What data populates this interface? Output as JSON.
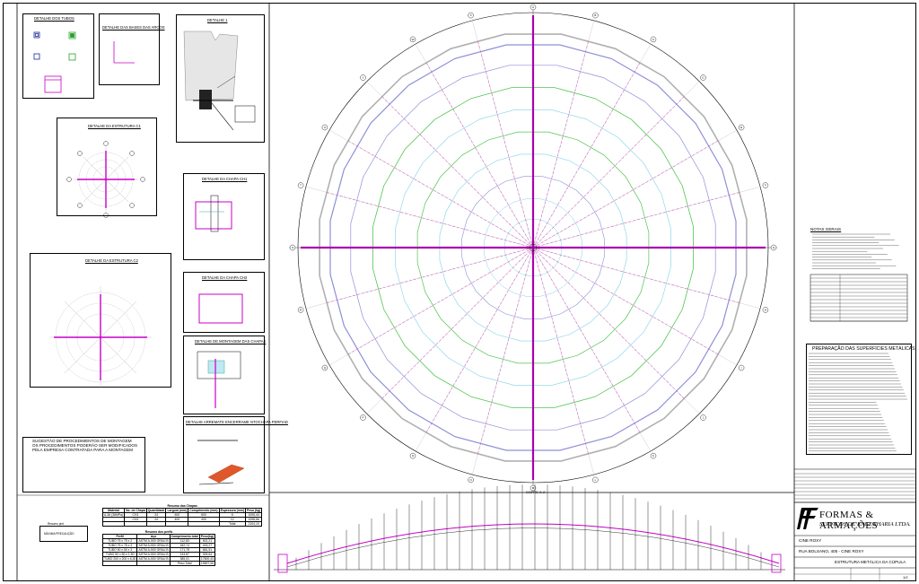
{
  "details": {
    "tubos": "DETALHE DOS TUBOS",
    "bases": "DETALHE DAS BASES DAS ARCOS",
    "d1": "DETALHE 1",
    "estrutura_c1": "DETALHE DA ESTRUTURA C1",
    "estrutura_c2": "DETALHE DA ESTRUTURA C2",
    "chapa_ch1": "DETALHE DA CHAPA CH1",
    "chapa_ch2": "DETALHE DA CHAPA CH2",
    "montagem": "DETALHE DE MONTAGEM DAS CHAPAS",
    "arremate": "DETALHE ARREMATE ENCERRAME NTOCHAPA PERFIAD"
  },
  "suggestion": {
    "title_lines": [
      "SUGESTÃO DE PROCEDIMENTOS DE MONTAGEM",
      "OS PROCEDIMENTOS PODERÃO SER MODIFICADOS",
      "PELA EMPRESA CONTRATADA PARA A MONTAGEM"
    ]
  },
  "notes": {
    "geral_title": "NOTAS GERAIS",
    "prep_title": "PREPARAÇÃO DAS SUPERFÍCIES METÁLICAS"
  },
  "plan": {
    "ring_labels": [
      "A",
      "B",
      "C",
      "D",
      "E",
      "F",
      "G",
      "H",
      "I",
      "J",
      "K",
      "L",
      "M",
      "N",
      "O",
      "P",
      "Q",
      "R",
      "S",
      "T",
      "U",
      "V",
      "W",
      "X"
    ],
    "corte_label": "CORTE A-A"
  },
  "chapas_table": {
    "title": "Resumo das Chapas",
    "headers": [
      "Material",
      "No. de Chapa",
      "Quantidade",
      "Largura (mm)",
      "Comprimento (mm)",
      "Espessura (mm)",
      "Peso (kg)"
    ],
    "rows": [
      [
        "A-36 (36MPa)",
        "CH1",
        "24",
        "600",
        "600",
        "6",
        "1005,44"
      ],
      [
        "",
        "CH2",
        "24",
        "400",
        "400",
        "12",
        "1098,66"
      ],
      [
        "",
        "",
        "",
        "",
        "",
        "Total",
        "2104,10"
      ]
    ]
  },
  "perfis_table": {
    "title": "Resumo dos perfis",
    "headers": [
      "Perfil",
      "Aço",
      "Comprimento total",
      "Peso(kg)"
    ],
    "rows": [
      [
        "TUBO 75 x 75 x 2",
        "ASTM A-500 GRAU B",
        "112,83",
        "502,21"
      ],
      [
        "TUBO 75 x 75 x 3",
        "ASTM A-500 GRAU B",
        "182,74",
        "403,27"
      ],
      [
        "TUBO 50 x 50 x 3",
        "ASTM A-500 GRAU B",
        "171,78",
        "681,51"
      ],
      [
        "TUBO 50 x 50 x 1,50",
        "ASTM A-500 GRAU B",
        "243,87",
        "309,64"
      ],
      [
        "TUBO 200 x 200 x 6,30",
        "ASTM A-500 GRAU B",
        "385,01",
        "17800,43"
      ],
      [
        "",
        "",
        "Peso Total",
        "19697,06"
      ]
    ]
  },
  "parafusos_box": {
    "title": "Resumo pint.",
    "line": "MÁXIMA PRECAUÇÃO"
  },
  "title_block": {
    "company_main": "FORMAS & ARMAÇÕES",
    "company_sub": "SERVIÇOS DE ENGENHARIA LTDA.",
    "client": "CINE ROXY",
    "address": "RUA BOLSANO, 405 - CINE ROXY",
    "subject": "ESTRUTURA METÁLICA DA CÚPULA",
    "sheet": "1/2"
  },
  "colors": {
    "pink": "#e14fd6",
    "magenta": "#c800c8",
    "purple": "#8f8fd8",
    "green": "#52c552",
    "cyan": "#7fd1e8",
    "gray": "#b0b0b0",
    "red": "#d94a1e",
    "bluegreen": "#3aa8a0"
  }
}
